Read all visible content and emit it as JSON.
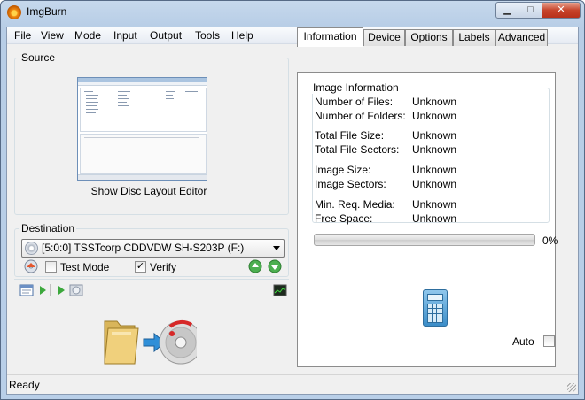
{
  "window": {
    "title": "ImgBurn",
    "controls": {
      "minimize": "▁",
      "maximize": "□",
      "close": "✕"
    }
  },
  "menu": [
    "File",
    "View",
    "Mode",
    "Input",
    "Output",
    "Tools",
    "Help"
  ],
  "source": {
    "group_label": "Source",
    "layout_editor_label": "Show Disc Layout Editor"
  },
  "destination": {
    "group_label": "Destination",
    "drive": "[5:0:0] TSSTcorp CDDVDW SH-S203P (F:)",
    "test_mode_label": "Test Mode",
    "test_mode_checked": false,
    "verify_label": "Verify",
    "verify_checked": true,
    "verify_mark": "✓"
  },
  "tabs": [
    "Information",
    "Device",
    "Options",
    "Labels",
    "Advanced"
  ],
  "active_tab": "Information",
  "info": {
    "title": "Image Information",
    "rows": [
      {
        "label": "Number of Files:",
        "value": "Unknown"
      },
      {
        "label": "Number of Folders:",
        "value": "Unknown"
      },
      {
        "label": "Total File Size:",
        "value": "Unknown"
      },
      {
        "label": "Total File Sectors:",
        "value": "Unknown"
      },
      {
        "label": "Image Size:",
        "value": "Unknown"
      },
      {
        "label": "Image Sectors:",
        "value": "Unknown"
      },
      {
        "label": "Min. Req. Media:",
        "value": "Unknown"
      },
      {
        "label": "Free Space:",
        "value": "Unknown"
      }
    ],
    "progress_percent": 0,
    "progress_text": "0%",
    "auto_label": "Auto",
    "auto_checked": false
  },
  "status": {
    "text": "Ready"
  },
  "icons": {
    "app": "imgburn-flame-icon",
    "calculator": "calculator-icon",
    "build": "folder-to-disc-icon"
  }
}
